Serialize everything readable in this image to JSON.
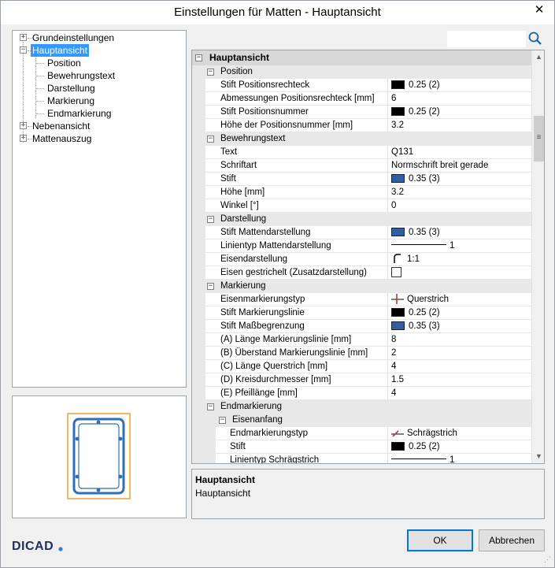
{
  "window": {
    "title": "Einstellungen für Matten - Hauptansicht",
    "close_glyph": "✕"
  },
  "tree": {
    "items": [
      {
        "label": "Grundeinstellungen",
        "level": 0,
        "expander": "+"
      },
      {
        "label": "Hauptansicht",
        "level": 0,
        "expander": "−",
        "selected": true
      },
      {
        "label": "Position",
        "level": 1
      },
      {
        "label": "Bewehrungstext",
        "level": 1
      },
      {
        "label": "Darstellung",
        "level": 1
      },
      {
        "label": "Markierung",
        "level": 1
      },
      {
        "label": "Endmarkierung",
        "level": 1
      },
      {
        "label": "Nebenansicht",
        "level": 0,
        "expander": "+"
      },
      {
        "label": "Mattenauszug",
        "level": 0,
        "expander": "+"
      }
    ]
  },
  "search": {
    "value": "",
    "placeholder": ""
  },
  "grid": {
    "rows": [
      {
        "kind": "top",
        "label": "Hauptansicht"
      },
      {
        "kind": "cat",
        "label": "Position",
        "depth": 1
      },
      {
        "kind": "prop",
        "label": "Stift Positionsrechteck",
        "value": "0.25 (2)",
        "swatch": "#000000",
        "depth": 1
      },
      {
        "kind": "prop",
        "label": "Abmessungen Positionsrechteck [mm]",
        "value": "6",
        "depth": 1
      },
      {
        "kind": "prop",
        "label": "Stift Positionsnummer",
        "value": "0.25 (2)",
        "swatch": "#000000",
        "depth": 1
      },
      {
        "kind": "prop",
        "label": "Höhe der Positionsnummer [mm]",
        "value": "3.2",
        "depth": 1
      },
      {
        "kind": "cat",
        "label": "Bewehrungstext",
        "depth": 1
      },
      {
        "kind": "prop",
        "label": "Text",
        "value": "Q131",
        "depth": 1
      },
      {
        "kind": "prop",
        "label": "Schriftart",
        "value": "Normschrift breit gerade",
        "depth": 1
      },
      {
        "kind": "prop",
        "label": "Stift",
        "value": "0.35 (3)",
        "swatch": "#2f5f9e",
        "depth": 1
      },
      {
        "kind": "prop",
        "label": "Höhe [mm]",
        "value": "3.2",
        "depth": 1
      },
      {
        "kind": "prop",
        "label": "Winkel [°]",
        "value": "0",
        "depth": 1
      },
      {
        "kind": "cat",
        "label": "Darstellung",
        "depth": 1
      },
      {
        "kind": "prop",
        "label": "Stift Mattendarstellung",
        "value": "0.35 (3)",
        "swatch": "#2f5f9e",
        "depth": 1
      },
      {
        "kind": "prop",
        "label": "Linientyp Mattendarstellung",
        "value": "1",
        "lineicon": true,
        "depth": 1
      },
      {
        "kind": "prop",
        "label": "Eisendarstellung",
        "value": "1:1",
        "icon": "bar-bend-icon",
        "depth": 1
      },
      {
        "kind": "prop",
        "label": "Eisen gestrichelt (Zusatzdarstellung)",
        "value": "",
        "checkbox": true,
        "depth": 1
      },
      {
        "kind": "cat",
        "label": "Markierung",
        "depth": 1
      },
      {
        "kind": "prop",
        "label": "Eisenmarkierungstyp",
        "value": "Querstrich",
        "icon": "cross-stroke-icon",
        "depth": 1
      },
      {
        "kind": "prop",
        "label": "Stift Markierungslinie",
        "value": "0.25 (2)",
        "swatch": "#000000",
        "depth": 1
      },
      {
        "kind": "prop",
        "label": "Stift Maßbegrenzung",
        "value": "0.35 (3)",
        "swatch": "#2f5f9e",
        "depth": 1
      },
      {
        "kind": "prop",
        "label": "(A) Länge Markierungslinie [mm]",
        "value": "8",
        "depth": 1
      },
      {
        "kind": "prop",
        "label": "(B) Überstand Markierungslinie [mm]",
        "value": "2",
        "depth": 1
      },
      {
        "kind": "prop",
        "label": "(C) Länge Querstrich [mm]",
        "value": "4",
        "depth": 1
      },
      {
        "kind": "prop",
        "label": "(D) Kreisdurchmesser [mm]",
        "value": "1.5",
        "depth": 1
      },
      {
        "kind": "prop",
        "label": "(E) Pfeillänge [mm]",
        "value": "4",
        "depth": 1
      },
      {
        "kind": "cat",
        "label": "Endmarkierung",
        "depth": 1
      },
      {
        "kind": "cat",
        "label": "Eisenanfang",
        "depth": 2
      },
      {
        "kind": "prop",
        "label": "Endmarkierungstyp",
        "value": "Schrägstrich",
        "icon": "slash-stroke-icon",
        "depth": 2
      },
      {
        "kind": "prop",
        "label": "Stift",
        "value": "0.25 (2)",
        "swatch": "#000000",
        "depth": 2
      },
      {
        "kind": "prop",
        "label": "Linientyp Schrägstrich",
        "value": "1",
        "lineicon": true,
        "depth": 2
      }
    ]
  },
  "description": {
    "title": "Hauptansicht",
    "text": "Hauptansicht"
  },
  "buttons": {
    "ok": "OK",
    "cancel": "Abbrechen"
  },
  "logo": {
    "text": "DICAD",
    "color": "#1d2f5c",
    "accent": "#2f7fd0"
  },
  "colors": {
    "selection": "#3399ff",
    "rebar_blue": "#2f6fb8",
    "preview_frame": "#f0a030"
  }
}
